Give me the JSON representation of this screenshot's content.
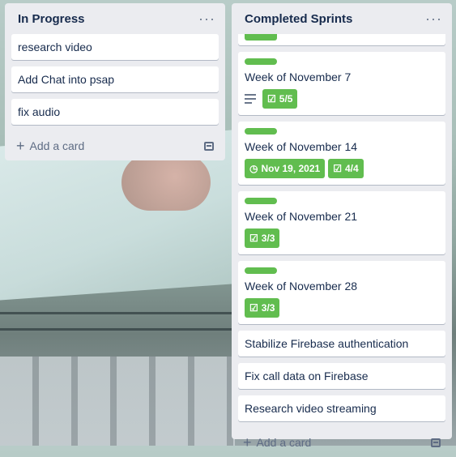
{
  "lists": [
    {
      "title": "In Progress",
      "cards": [
        "research video",
        "Add Chat into psap",
        "fix audio"
      ],
      "add_card": "Add a card"
    },
    {
      "title": "Completed Sprints",
      "cards": [
        {
          "title": "Week of November 7",
          "checklist": "5/5",
          "has_description": true
        },
        {
          "title": "Week of November 14",
          "due": "Nov 19, 2021",
          "checklist": "4/4"
        },
        {
          "title": "Week of November 21",
          "checklist": "3/3"
        },
        {
          "title": "Week of November 28",
          "checklist": "3/3"
        },
        {
          "title": "Stabilize Firebase authentication"
        },
        {
          "title": "Fix call data on Firebase"
        },
        {
          "title": "Research video streaming"
        }
      ],
      "add_card": "Add a card"
    }
  ],
  "colors": {
    "label_green": "#61bd4f",
    "list_bg": "#ebecf0"
  }
}
